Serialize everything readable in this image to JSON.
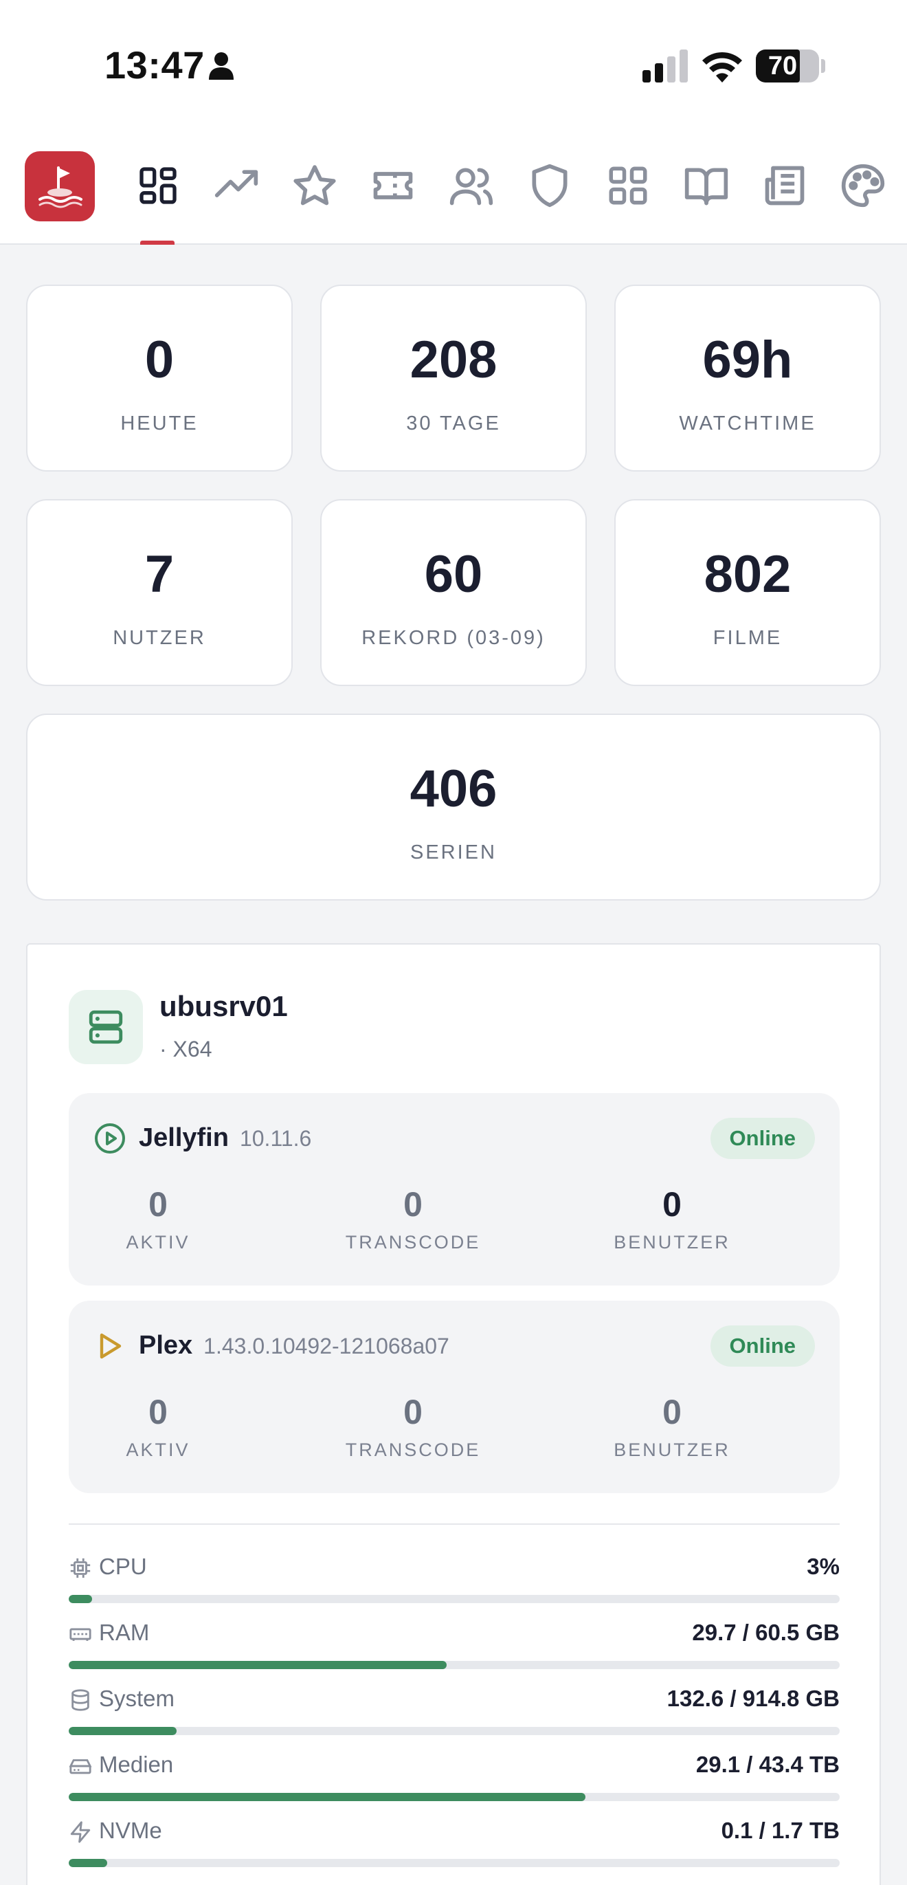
{
  "status_bar": {
    "time": "13:47",
    "battery": "70",
    "battery_level": 0.7
  },
  "nav": {
    "logo": "flag-logo",
    "items": [
      {
        "icon": "dashboard-grid-icon",
        "active": true
      },
      {
        "icon": "trending-icon"
      },
      {
        "icon": "star-icon"
      },
      {
        "icon": "ticket-icon"
      },
      {
        "icon": "users-icon"
      },
      {
        "icon": "shield-icon"
      },
      {
        "icon": "apps-grid-icon"
      },
      {
        "icon": "book-icon"
      },
      {
        "icon": "newspaper-icon"
      },
      {
        "icon": "palette-icon"
      }
    ],
    "accent": "#d03a45"
  },
  "stats": [
    {
      "value": "0",
      "label": "HEUTE"
    },
    {
      "value": "208",
      "label": "30 TAGE"
    },
    {
      "value": "69h",
      "label": "WATCHTIME"
    },
    {
      "value": "7",
      "label": "NUTZER"
    },
    {
      "value": "60",
      "label": "REKORD (03-09)"
    },
    {
      "value": "802",
      "label": "FILME"
    },
    {
      "value": "406",
      "label": "SERIEN"
    }
  ],
  "server": {
    "name": "ubusrv01",
    "subtitle": "· X64",
    "services": [
      {
        "name": "Jellyfin",
        "version": "10.11.6",
        "status": "Online",
        "metrics": [
          {
            "value": "0",
            "label": "AKTIV"
          },
          {
            "value": "0",
            "label": "TRANSCODE"
          },
          {
            "value": "0",
            "label": "BENUTZER"
          }
        ]
      },
      {
        "name": "Plex",
        "version": "1.43.0.10492-121068a07",
        "status": "Online",
        "metrics": [
          {
            "value": "0",
            "label": "AKTIV"
          },
          {
            "value": "0",
            "label": "TRANSCODE"
          },
          {
            "value": "0",
            "label": "BENUTZER"
          }
        ]
      }
    ],
    "resources": [
      {
        "label": "CPU",
        "value": "3%",
        "fraction": 0.03,
        "icon": "cpu-icon"
      },
      {
        "label": "RAM",
        "value": "29.7 / 60.5 GB",
        "fraction": 0.49,
        "icon": "memory-icon"
      },
      {
        "label": "System",
        "value": "132.6 / 914.8 GB",
        "fraction": 0.14,
        "icon": "database-icon"
      },
      {
        "label": "Medien",
        "value": "29.1 / 43.4 TB",
        "fraction": 0.67,
        "icon": "harddrive-icon"
      },
      {
        "label": "NVMe",
        "value": "0.1 / 1.7 TB",
        "fraction": 0.05,
        "icon": "lightning-icon"
      }
    ],
    "accent": "#3d8c5f"
  }
}
